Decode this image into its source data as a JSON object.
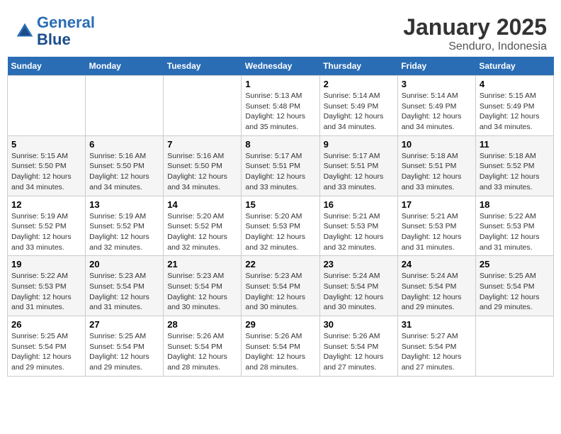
{
  "header": {
    "logo_line1": "General",
    "logo_line2": "Blue",
    "month": "January 2025",
    "location": "Senduro, Indonesia"
  },
  "weekdays": [
    "Sunday",
    "Monday",
    "Tuesday",
    "Wednesday",
    "Thursday",
    "Friday",
    "Saturday"
  ],
  "weeks": [
    [
      {
        "day": "",
        "info": ""
      },
      {
        "day": "",
        "info": ""
      },
      {
        "day": "",
        "info": ""
      },
      {
        "day": "1",
        "info": "Sunrise: 5:13 AM\nSunset: 5:48 PM\nDaylight: 12 hours\nand 35 minutes."
      },
      {
        "day": "2",
        "info": "Sunrise: 5:14 AM\nSunset: 5:49 PM\nDaylight: 12 hours\nand 34 minutes."
      },
      {
        "day": "3",
        "info": "Sunrise: 5:14 AM\nSunset: 5:49 PM\nDaylight: 12 hours\nand 34 minutes."
      },
      {
        "day": "4",
        "info": "Sunrise: 5:15 AM\nSunset: 5:49 PM\nDaylight: 12 hours\nand 34 minutes."
      }
    ],
    [
      {
        "day": "5",
        "info": "Sunrise: 5:15 AM\nSunset: 5:50 PM\nDaylight: 12 hours\nand 34 minutes."
      },
      {
        "day": "6",
        "info": "Sunrise: 5:16 AM\nSunset: 5:50 PM\nDaylight: 12 hours\nand 34 minutes."
      },
      {
        "day": "7",
        "info": "Sunrise: 5:16 AM\nSunset: 5:50 PM\nDaylight: 12 hours\nand 34 minutes."
      },
      {
        "day": "8",
        "info": "Sunrise: 5:17 AM\nSunset: 5:51 PM\nDaylight: 12 hours\nand 33 minutes."
      },
      {
        "day": "9",
        "info": "Sunrise: 5:17 AM\nSunset: 5:51 PM\nDaylight: 12 hours\nand 33 minutes."
      },
      {
        "day": "10",
        "info": "Sunrise: 5:18 AM\nSunset: 5:51 PM\nDaylight: 12 hours\nand 33 minutes."
      },
      {
        "day": "11",
        "info": "Sunrise: 5:18 AM\nSunset: 5:52 PM\nDaylight: 12 hours\nand 33 minutes."
      }
    ],
    [
      {
        "day": "12",
        "info": "Sunrise: 5:19 AM\nSunset: 5:52 PM\nDaylight: 12 hours\nand 33 minutes."
      },
      {
        "day": "13",
        "info": "Sunrise: 5:19 AM\nSunset: 5:52 PM\nDaylight: 12 hours\nand 32 minutes."
      },
      {
        "day": "14",
        "info": "Sunrise: 5:20 AM\nSunset: 5:52 PM\nDaylight: 12 hours\nand 32 minutes."
      },
      {
        "day": "15",
        "info": "Sunrise: 5:20 AM\nSunset: 5:53 PM\nDaylight: 12 hours\nand 32 minutes."
      },
      {
        "day": "16",
        "info": "Sunrise: 5:21 AM\nSunset: 5:53 PM\nDaylight: 12 hours\nand 32 minutes."
      },
      {
        "day": "17",
        "info": "Sunrise: 5:21 AM\nSunset: 5:53 PM\nDaylight: 12 hours\nand 31 minutes."
      },
      {
        "day": "18",
        "info": "Sunrise: 5:22 AM\nSunset: 5:53 PM\nDaylight: 12 hours\nand 31 minutes."
      }
    ],
    [
      {
        "day": "19",
        "info": "Sunrise: 5:22 AM\nSunset: 5:53 PM\nDaylight: 12 hours\nand 31 minutes."
      },
      {
        "day": "20",
        "info": "Sunrise: 5:23 AM\nSunset: 5:54 PM\nDaylight: 12 hours\nand 31 minutes."
      },
      {
        "day": "21",
        "info": "Sunrise: 5:23 AM\nSunset: 5:54 PM\nDaylight: 12 hours\nand 30 minutes."
      },
      {
        "day": "22",
        "info": "Sunrise: 5:23 AM\nSunset: 5:54 PM\nDaylight: 12 hours\nand 30 minutes."
      },
      {
        "day": "23",
        "info": "Sunrise: 5:24 AM\nSunset: 5:54 PM\nDaylight: 12 hours\nand 30 minutes."
      },
      {
        "day": "24",
        "info": "Sunrise: 5:24 AM\nSunset: 5:54 PM\nDaylight: 12 hours\nand 29 minutes."
      },
      {
        "day": "25",
        "info": "Sunrise: 5:25 AM\nSunset: 5:54 PM\nDaylight: 12 hours\nand 29 minutes."
      }
    ],
    [
      {
        "day": "26",
        "info": "Sunrise: 5:25 AM\nSunset: 5:54 PM\nDaylight: 12 hours\nand 29 minutes."
      },
      {
        "day": "27",
        "info": "Sunrise: 5:25 AM\nSunset: 5:54 PM\nDaylight: 12 hours\nand 29 minutes."
      },
      {
        "day": "28",
        "info": "Sunrise: 5:26 AM\nSunset: 5:54 PM\nDaylight: 12 hours\nand 28 minutes."
      },
      {
        "day": "29",
        "info": "Sunrise: 5:26 AM\nSunset: 5:54 PM\nDaylight: 12 hours\nand 28 minutes."
      },
      {
        "day": "30",
        "info": "Sunrise: 5:26 AM\nSunset: 5:54 PM\nDaylight: 12 hours\nand 27 minutes."
      },
      {
        "day": "31",
        "info": "Sunrise: 5:27 AM\nSunset: 5:54 PM\nDaylight: 12 hours\nand 27 minutes."
      },
      {
        "day": "",
        "info": ""
      }
    ]
  ]
}
